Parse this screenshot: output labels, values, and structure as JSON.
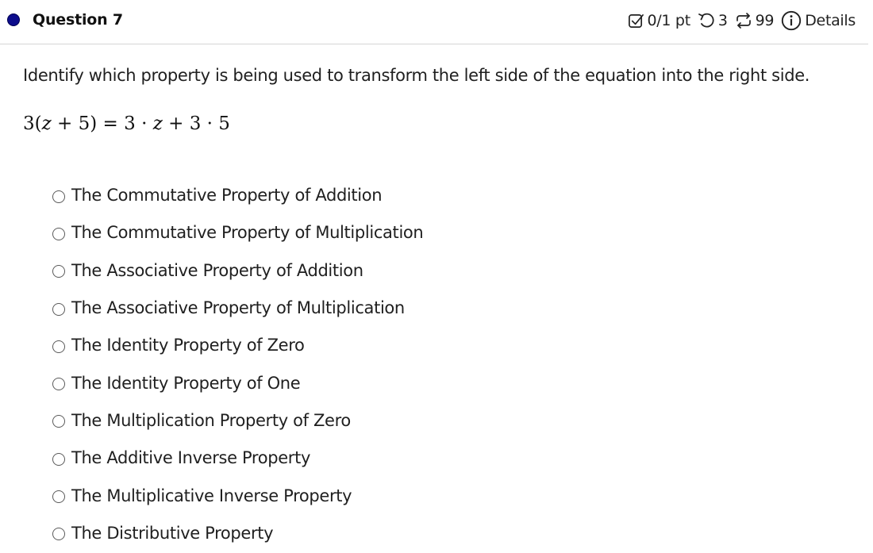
{
  "question": {
    "title": "Question 7",
    "score": "0/1 pt",
    "attempts_icon": "undo-icon",
    "attempts": "3",
    "versions_icon": "repeat-icon",
    "versions": "99",
    "details_icon": "info-icon",
    "details_label": "Details",
    "score_icon": "checkbox-icon",
    "status_color": "#0d0d8c"
  },
  "prompt": "Identify which property is being used to transform the left side of the equation into the right side.",
  "equation": {
    "lhs_coef": "3(",
    "lhs_var": "z",
    "lhs_rest": " + 5)",
    "equals": " = ",
    "rhs_a": "3 · ",
    "rhs_var": "z",
    "rhs_b": " + 3 · 5"
  },
  "options": [
    "The Commutative Property of Addition",
    "The Commutative Property of Multiplication",
    "The Associative Property of Addition",
    "The Associative Property of Multiplication",
    "The Identity Property of Zero",
    "The Identity Property of One",
    "The Multiplication Property of Zero",
    "The Additive Inverse Property",
    "The Multiplicative Inverse Property",
    "The Distributive Property"
  ]
}
